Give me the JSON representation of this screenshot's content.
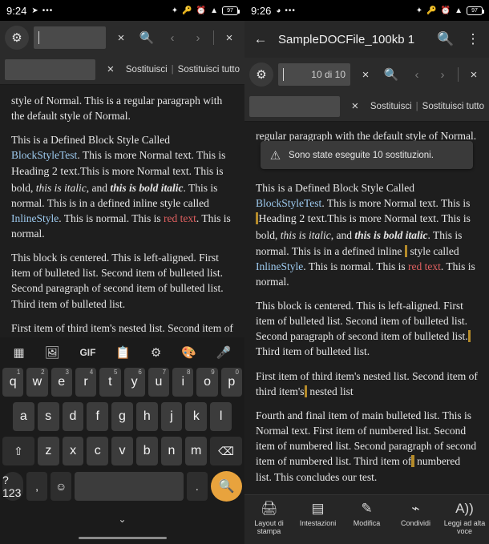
{
  "left": {
    "status": {
      "clock": "9:24",
      "left_icons": [
        "send-icon",
        "more-icon"
      ],
      "right_icons": [
        "bluetooth-icon",
        "vpn-icon",
        "alarm-icon",
        "wifi-icon"
      ],
      "battery": "97"
    },
    "toolbar": {
      "gear": "gear-icon",
      "search_value": "",
      "clear": "×",
      "search": "search-icon",
      "prev": "‹",
      "next": "›",
      "close": "×"
    },
    "replacebar": {
      "replace_value": "",
      "clear": "×",
      "replace_one": "Sostituisci",
      "separator": "|",
      "replace_all": "Sostituisci tutto"
    },
    "doc": {
      "p1": "style of Normal. This is a  regular paragraph with the default style of Normal.",
      "p2_a": "This is a Defined Block Style Called ",
      "p2_blockstyle": "BlockStyleTest",
      "p2_b": ". This is more Normal text. This is  ",
      "p2_h2": "Heading 2 text.",
      "p2_c": "This  is  more Normal text. This is bold, ",
      "p2_italic": "this is italic",
      "p2_d": ", and ",
      "p2_bolditalic": "this is bold italic",
      "p2_e": ". This is normal. This is in a defined inline  style called ",
      "p2_inline": "InlineStyle",
      "p2_f": ". This is normal. This is ",
      "p2_red": "red text",
      "p2_g": ". This is normal.",
      "p3": "This block is centered. This is left-aligned. First item of bulleted list. Second item of bulleted list. Second paragraph of second item of bulleted list.  Third item of bulleted list.",
      "p4": "First item of third item's nested list. Second item of third item's  nested list"
    },
    "keyboard": {
      "toolbar_icons": [
        "apps-icon",
        "sticker-icon",
        "gif-icon",
        "clipboard-icon",
        "settings-icon",
        "theme-icon",
        "mic-icon"
      ],
      "gif_label": "GIF",
      "row1": [
        {
          "k": "q",
          "n": "1"
        },
        {
          "k": "w",
          "n": "2"
        },
        {
          "k": "e",
          "n": "3"
        },
        {
          "k": "r",
          "n": "4"
        },
        {
          "k": "t",
          "n": "5"
        },
        {
          "k": "y",
          "n": "6"
        },
        {
          "k": "u",
          "n": "7"
        },
        {
          "k": "i",
          "n": "8"
        },
        {
          "k": "o",
          "n": "9"
        },
        {
          "k": "p",
          "n": "0"
        }
      ],
      "row2": [
        "a",
        "s",
        "d",
        "f",
        "g",
        "h",
        "j",
        "k",
        "l"
      ],
      "row3_shift": "⇧",
      "row3": [
        "z",
        "x",
        "c",
        "v",
        "b",
        "n",
        "m"
      ],
      "row3_back": "⌫",
      "row4_sym": "?123",
      "row4_comma": ",",
      "row4_emoji": "☺",
      "row4_space": "",
      "row4_period": ".",
      "row4_search": "search-icon",
      "hide": "⌄"
    }
  },
  "right": {
    "status": {
      "clock": "9:26",
      "left_icons": [
        "whatsapp-icon",
        "more-icon"
      ],
      "right_icons": [
        "bluetooth-icon",
        "vpn-icon",
        "alarm-icon",
        "wifi-icon"
      ],
      "battery": "97"
    },
    "header": {
      "back": "←",
      "title": "SampleDOCFile_100kb 1",
      "search": "search-icon",
      "overflow": "⋮"
    },
    "toolbar": {
      "gear": "gear-icon",
      "search_value": "",
      "match_count": "10 di 10",
      "clear": "×",
      "search": "search-icon",
      "prev": "‹",
      "next": "›",
      "close": "×"
    },
    "replacebar": {
      "replace_value": "",
      "clear": "×",
      "replace_one": "Sostituisci",
      "separator": "|",
      "replace_all": "Sostituisci tutto"
    },
    "toast": {
      "icon": "warning-icon",
      "message": "Sono state eseguite 10 sostituzioni."
    },
    "doc": {
      "p1": "regular paragraph with the default style of Normal.",
      "p2_a": "This is a Defined Block Style Called ",
      "p2_blockstyle": "BlockStyleTest",
      "p2_b": ". This is more Normal text. This is ",
      "p2_h2": "Heading 2 text.",
      "p2_c": "This is  more Normal text. This is bold, ",
      "p2_italic": "this is italic",
      "p2_d": ", and ",
      "p2_bolditalic": "this is bold italic",
      "p2_e": ". This is normal. This is in a defined inline ",
      "p2_e2": " style called ",
      "p2_inline": "InlineStyle",
      "p2_f": ". This is normal. This is ",
      "p2_red": "red text",
      "p2_g": ". This is normal.",
      "p3_a": "This block is centered. This is left-aligned. First item of bulleted list. Second item of bulleted list. Second paragraph of second item of bulleted list.",
      "p3_b": " Third item of bulleted list.",
      "p4_a": "First item of third item's nested list. Second item of third item's",
      "p4_b": " nested list",
      "p5_a": "Fourth and final item of main bulleted list. This is Normal text. First item of numbered list. Second item of numbered list. Second paragraph of second item of numbered list. Third item of",
      "p5_b": " numbered list. This concludes our test."
    },
    "tabs": [
      {
        "icon": "print-layout-icon",
        "label": "Layout di stampa"
      },
      {
        "icon": "headings-icon",
        "label": "Intestazioni"
      },
      {
        "icon": "edit-icon",
        "label": "Modifica"
      },
      {
        "icon": "share-icon",
        "label": "Condividi"
      },
      {
        "icon": "read-aloud-icon",
        "label": "Leggi ad alta voce"
      }
    ]
  }
}
